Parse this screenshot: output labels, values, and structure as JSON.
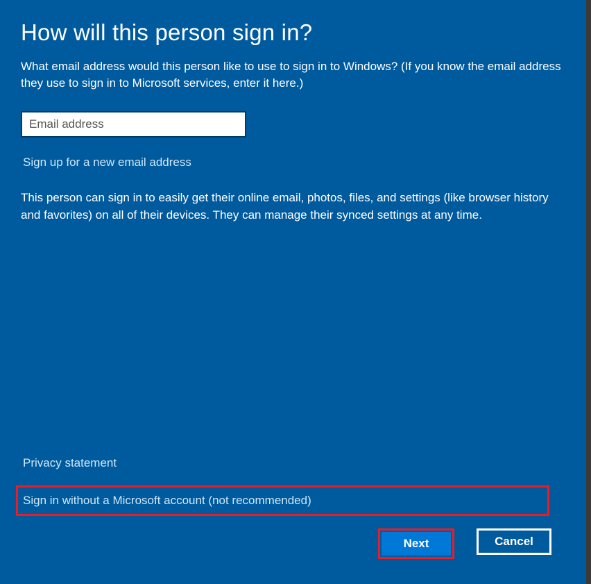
{
  "title": "How will this person sign in?",
  "subtitle": "What email address would this person like to use to sign in to Windows? (If you know the email address they use to sign in to Microsoft services, enter it here.)",
  "emailInput": {
    "placeholder": "Email address",
    "value": ""
  },
  "links": {
    "signup": "Sign up for a new email address",
    "privacy": "Privacy statement",
    "signinWithout": "Sign in without a Microsoft account (not recommended)"
  },
  "description": "This person can sign in to easily get their online email, photos, files, and settings (like browser history and favorites) on all of their devices. They can manage their synced settings at any time.",
  "buttons": {
    "next": "Next",
    "cancel": "Cancel"
  }
}
